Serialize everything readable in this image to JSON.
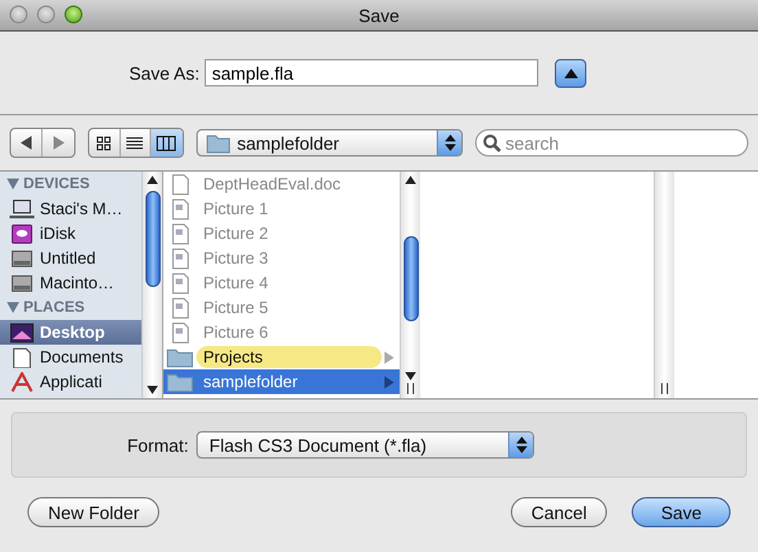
{
  "window": {
    "title": "Save"
  },
  "save_as": {
    "label": "Save As:",
    "value": "sample.fla",
    "expanded": true
  },
  "view_modes": [
    {
      "kind": "icon",
      "selected": false
    },
    {
      "kind": "list",
      "selected": false
    },
    {
      "kind": "column",
      "selected": true
    }
  ],
  "location": {
    "value": "samplefolder"
  },
  "search": {
    "placeholder": "search"
  },
  "sidebar": {
    "sections": [
      {
        "title": "DEVICES",
        "items": [
          {
            "label": "Staci's M…",
            "kind": "laptop",
            "selected": false
          },
          {
            "label": "iDisk",
            "kind": "idisk",
            "selected": false
          },
          {
            "label": "Untitled",
            "kind": "drive",
            "selected": false
          },
          {
            "label": "Macinto…",
            "kind": "drive",
            "selected": false
          }
        ]
      },
      {
        "title": "PLACES",
        "items": [
          {
            "label": "Desktop",
            "kind": "desktop",
            "selected": true
          },
          {
            "label": "Documents",
            "kind": "documents",
            "selected": false
          },
          {
            "label": "Applicati",
            "kind": "applications",
            "selected": false
          }
        ]
      }
    ]
  },
  "columns": [
    {
      "items": [
        {
          "name": "DeptHeadEval.doc",
          "kind": "doc",
          "selected": false
        },
        {
          "name": "Picture 1",
          "kind": "image",
          "selected": false
        },
        {
          "name": "Picture 2",
          "kind": "image",
          "selected": false
        },
        {
          "name": "Picture 3",
          "kind": "image",
          "selected": false
        },
        {
          "name": "Picture 4",
          "kind": "image",
          "selected": false
        },
        {
          "name": "Picture 5",
          "kind": "image",
          "selected": false
        },
        {
          "name": "Picture 6",
          "kind": "image",
          "selected": false
        },
        {
          "name": "Projects",
          "kind": "folder",
          "selected": false,
          "color": "#f6e985"
        },
        {
          "name": "samplefolder",
          "kind": "folder",
          "selected": true
        }
      ]
    }
  ],
  "format": {
    "label": "Format:",
    "value": "Flash CS3 Document (*.fla)"
  },
  "buttons": [
    {
      "label": "New Folder",
      "default": false
    },
    {
      "label": "Cancel",
      "default": false
    },
    {
      "label": "Save",
      "default": true
    }
  ]
}
